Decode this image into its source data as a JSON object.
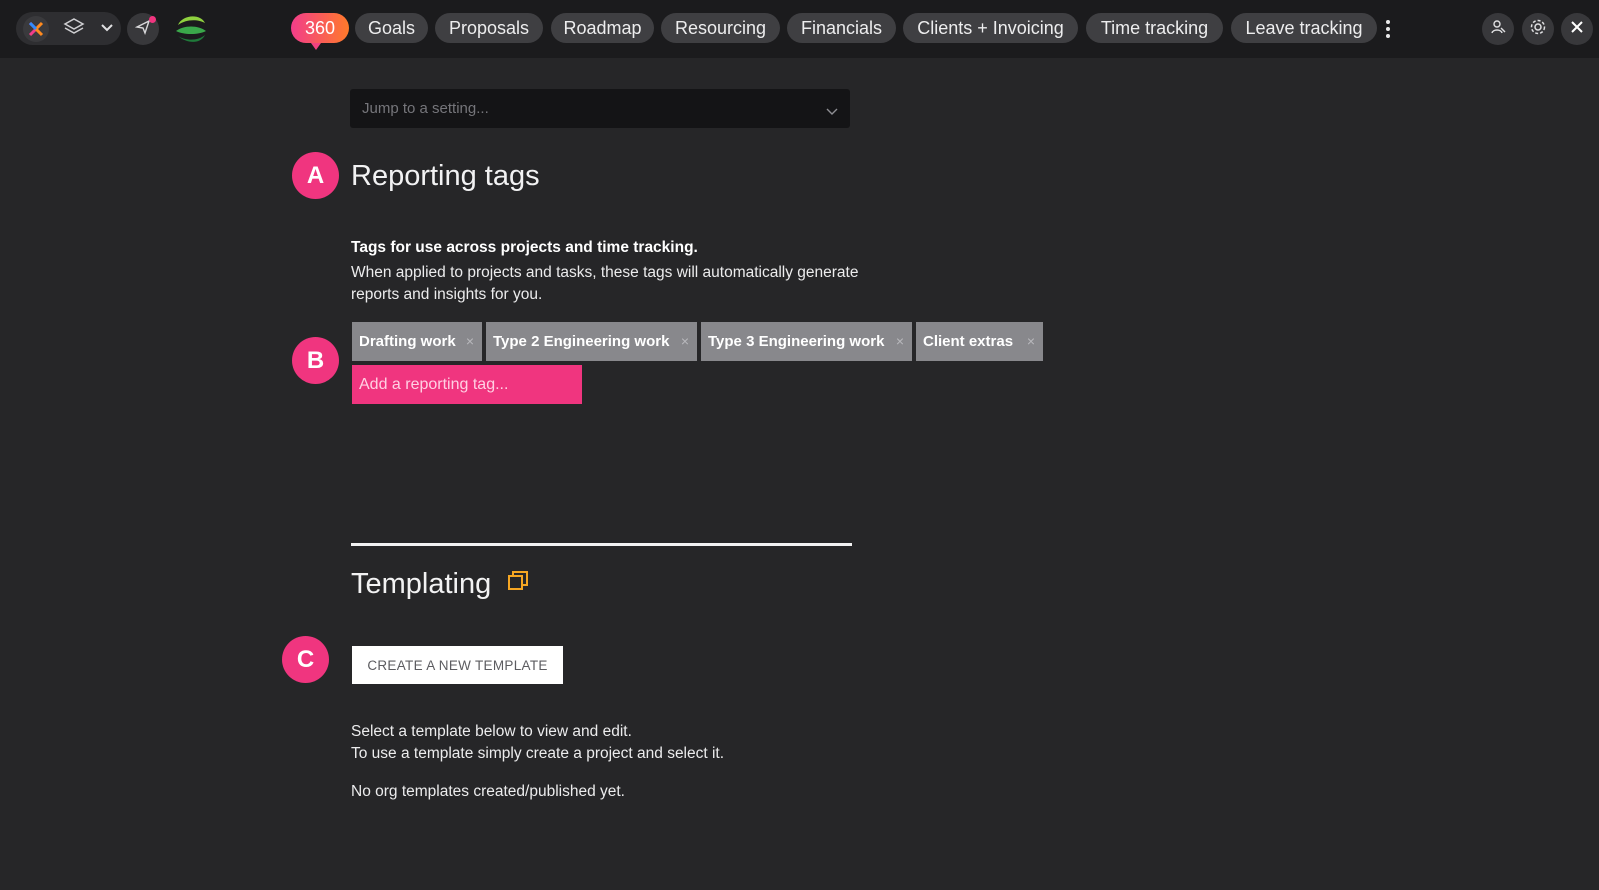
{
  "topbar": {
    "badge_count": "360",
    "tabs": [
      "Goals",
      "Proposals",
      "Roadmap",
      "Resourcing",
      "Financials",
      "Clients + Invoicing",
      "Time tracking",
      "Leave tracking"
    ],
    "icons": {
      "app_logo": "x-logo-icon",
      "layers": "layers-icon",
      "dropdown": "chevron-down-icon",
      "send": "paper-plane-icon",
      "brand": "green-swirl-logo",
      "more": "kebab-menu-icon",
      "user": "user-switch-icon",
      "settings": "gear-icon",
      "close": "close-icon"
    },
    "colors": {
      "badge_gradient_start": "#f23d8a",
      "badge_gradient_end": "#ff7a2a"
    }
  },
  "search": {
    "placeholder": "Jump to a setting..."
  },
  "markers": {
    "a": "A",
    "b": "B",
    "c": "C"
  },
  "reporting_tags": {
    "title": "Reporting tags",
    "description_bold": "Tags for use across projects and time tracking.",
    "description_line1": "When applied to projects and tasks, these tags will automatically generate",
    "description_line2": "reports and insights for you.",
    "tags": [
      "Drafting work",
      "Type 2 Engineering work",
      "Type 3 Engineering work",
      "Client extras"
    ],
    "remove_glyph": "×",
    "add_placeholder": "Add a reporting tag..."
  },
  "templating": {
    "title": "Templating",
    "create_button": "CREATE A NEW TEMPLATE",
    "info_line1": "Select a template below to view and edit.",
    "info_line2": "To use a template simply create a project and select it.",
    "empty_message": "No org templates created/published yet."
  },
  "accent_color": "#f0357f"
}
